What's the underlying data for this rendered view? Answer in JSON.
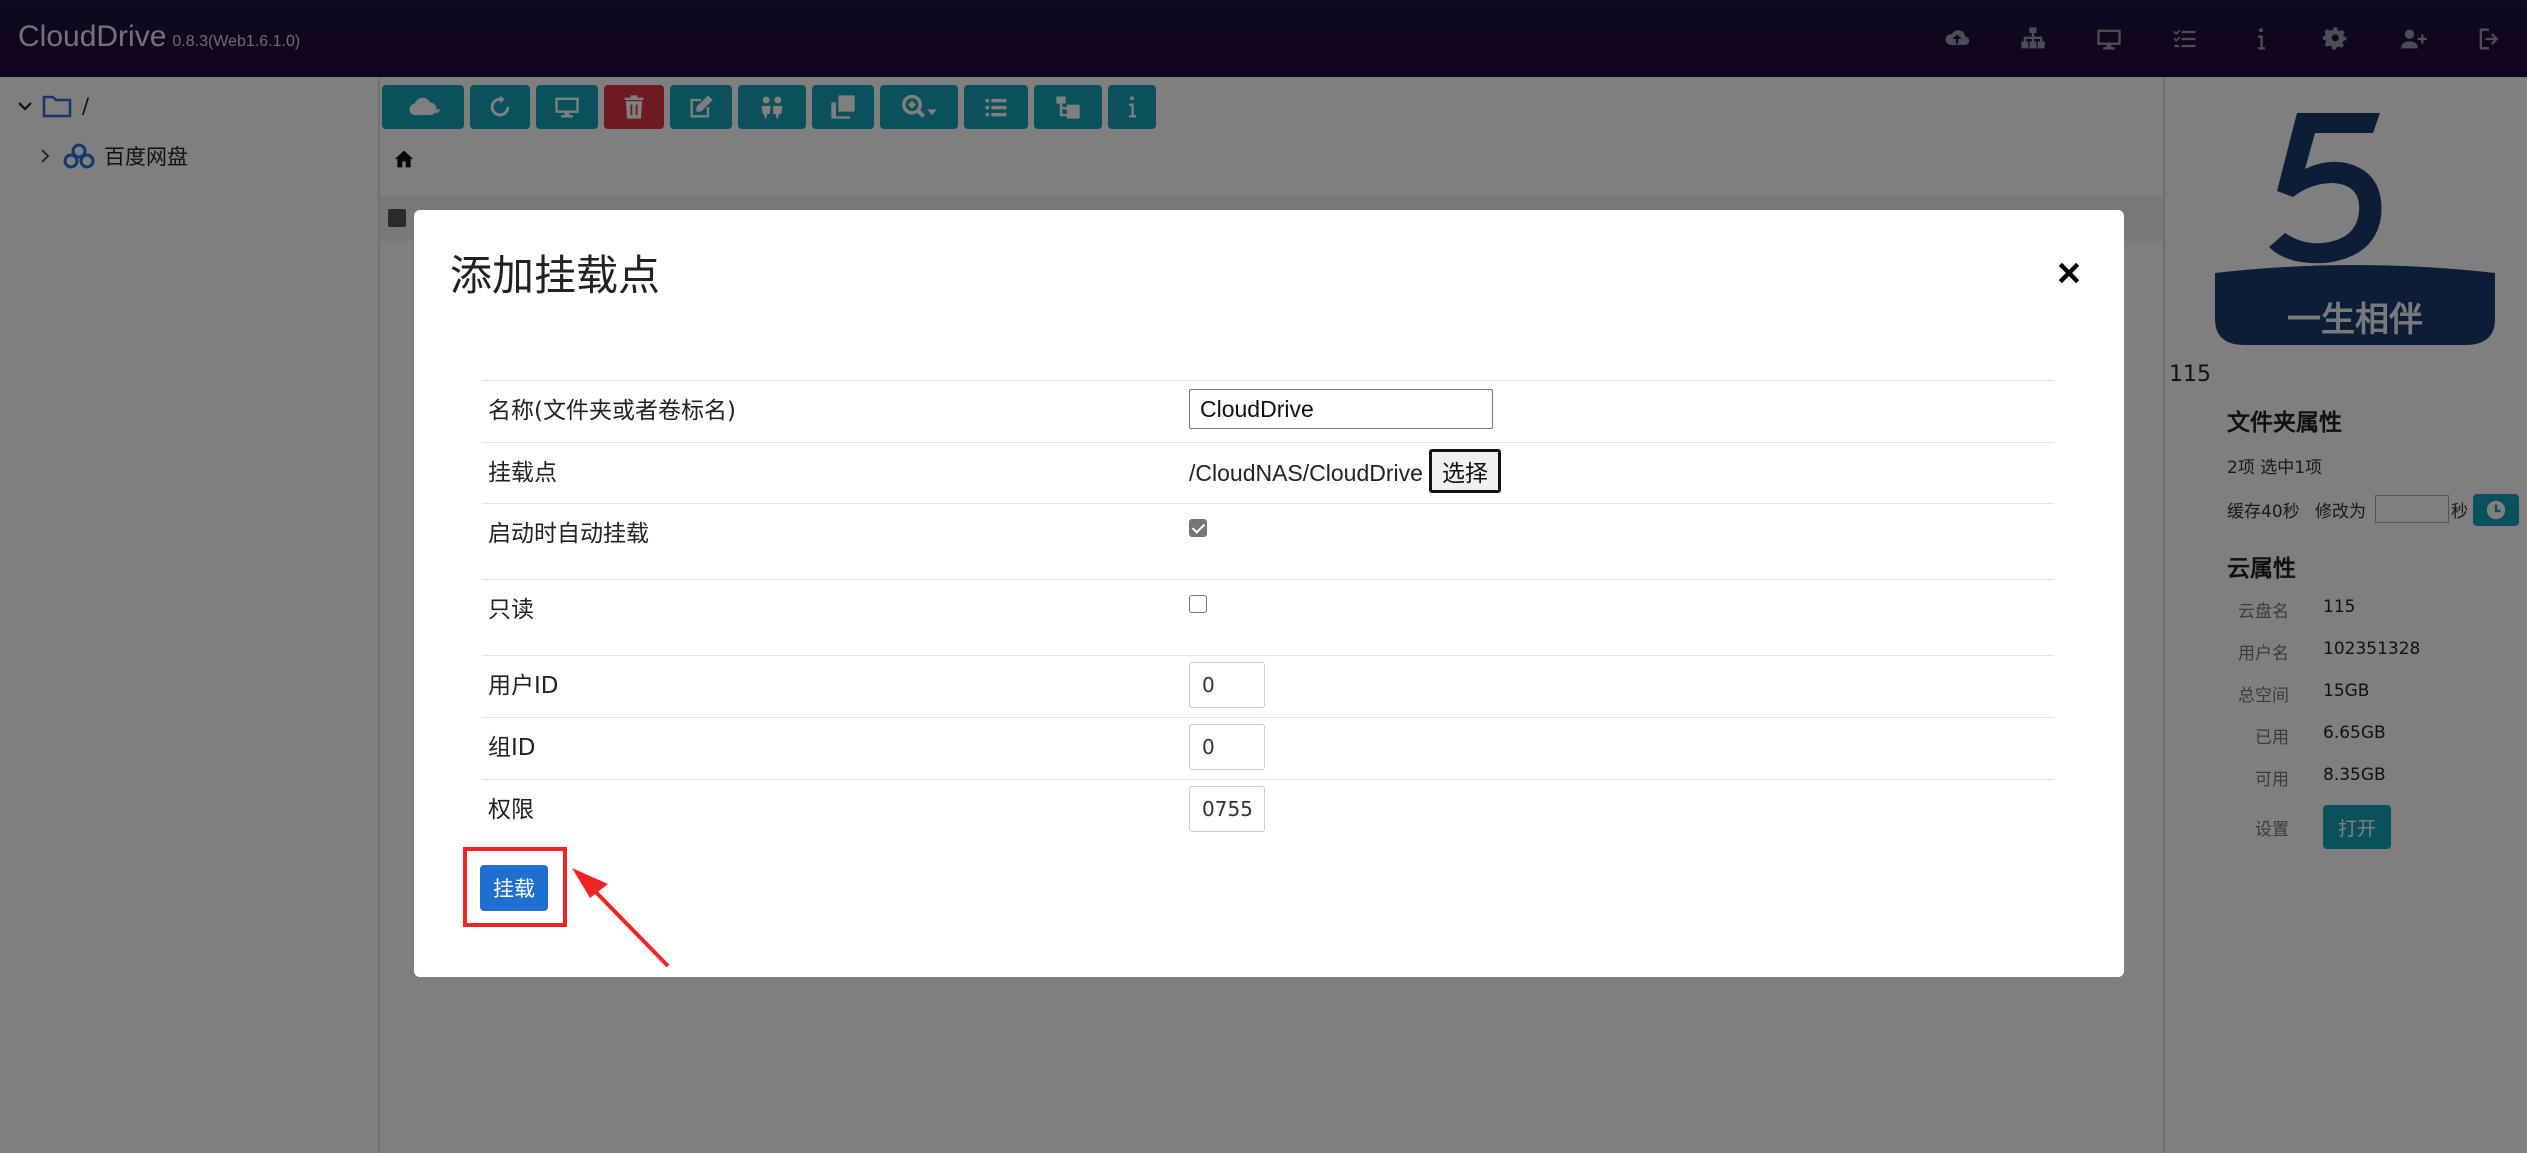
{
  "app": {
    "title": "CloudDrive",
    "version": "0.8.3(Web1.6.1.0)"
  },
  "nav_icons": [
    "cloud-upload-icon",
    "sitemap-icon",
    "desktop-icon",
    "tasks-icon",
    "info-icon",
    "settings-icon",
    "add-user-icon",
    "logout-icon"
  ],
  "tree": {
    "root_label": "/",
    "items": [
      {
        "label": "百度网盘"
      }
    ]
  },
  "toolbar": {
    "buttons": [
      "cloud-dropdown",
      "refresh",
      "desktop",
      "delete",
      "edit",
      "share",
      "copy",
      "search-dropdown",
      "list",
      "tree",
      "info"
    ]
  },
  "right_panel": {
    "logo_number": "5",
    "logo_text": "一生相伴",
    "cloud_label": "115",
    "folder_props": {
      "title": "文件夹属性",
      "summary": "2项   选中1项",
      "cache_label": "缓存40秒",
      "modify_label": "修改为",
      "seconds_label": "秒"
    },
    "cloud_props": {
      "title": "云属性",
      "rows": [
        {
          "label": "云盘名",
          "value": "115"
        },
        {
          "label": "用户名",
          "value": "102351328"
        },
        {
          "label": "总空间",
          "value": "15GB"
        },
        {
          "label": "已用",
          "value": "6.65GB"
        },
        {
          "label": "可用",
          "value": "8.35GB"
        }
      ],
      "settings_label": "设置",
      "open_button": "打开"
    }
  },
  "modal": {
    "title": "添加挂载点",
    "close_symbol": "×",
    "fields": {
      "name": {
        "label": "名称(文件夹或者卷标名)",
        "value": "CloudDrive"
      },
      "mount_point": {
        "label": "挂载点",
        "value": "/CloudNAS/CloudDrive",
        "choose_button": "选择"
      },
      "auto_mount": {
        "label": "启动时自动挂载",
        "checked": true
      },
      "read_only": {
        "label": "只读",
        "checked": false
      },
      "user_id": {
        "label": "用户ID",
        "value": "0"
      },
      "group_id": {
        "label": "组ID",
        "value": "0"
      },
      "permission": {
        "label": "权限",
        "value": "0755"
      }
    },
    "submit_button": "挂载"
  },
  "colors": {
    "navbar": "#1b1547",
    "toolbar_button": "#17a2b8",
    "delete_button": "#dc3545",
    "primary": "#1e6fd0",
    "highlight": "#ef2525",
    "logo": "#1d3b6e"
  }
}
